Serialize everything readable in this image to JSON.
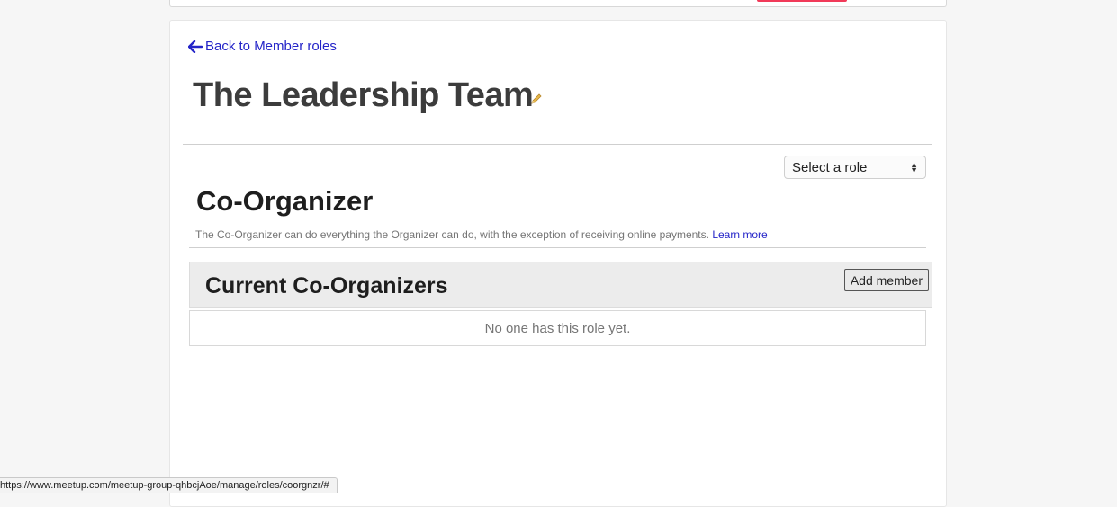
{
  "header": {
    "accent_color": "#f13a59"
  },
  "back_link": {
    "label": "Back to Member roles",
    "icon": "arrow-left-icon",
    "color": "#2424c8"
  },
  "team": {
    "title": "The Leadership Team",
    "edit_icon": "pencil-icon"
  },
  "role_select": {
    "selected": "Select a role",
    "icon": "select-arrows-icon"
  },
  "role": {
    "heading": "Co-Organizer",
    "description": "The Co-Organizer can do everything the Organizer can do, with the exception of receiving online payments.",
    "learn_more": "Learn more"
  },
  "members": {
    "title": "Current Co-Organizers",
    "add_button": "Add member",
    "empty_message": "No one has this role yet."
  },
  "status_bar": {
    "url": "https://www.meetup.com/meetup-group-qhbcjAoe/manage/roles/coorgnzr/#"
  }
}
